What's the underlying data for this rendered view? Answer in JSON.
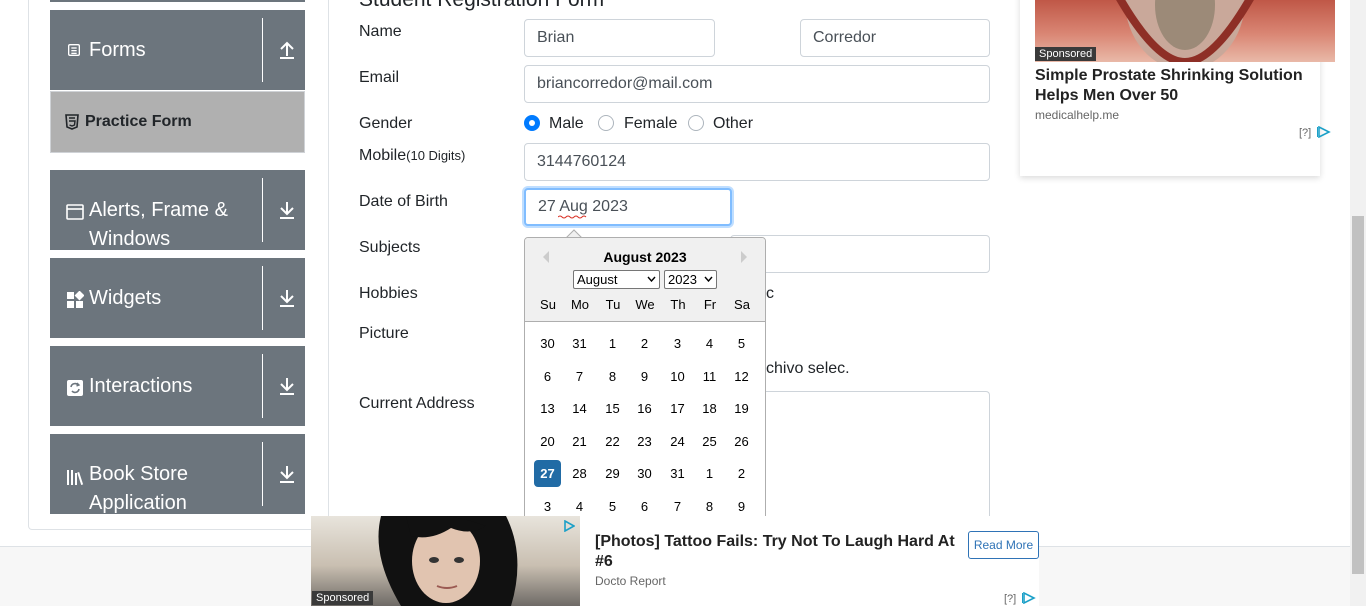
{
  "sidebar": {
    "groups": [
      {
        "label": "Forms",
        "icon": "document-icon",
        "arrow": "upload-arrow-icon"
      },
      {
        "label": "Alerts, Frame & Windows",
        "icon": "window-icon",
        "arrow": "download-arrow-icon"
      },
      {
        "label": "Widgets",
        "icon": "widgets-icon",
        "arrow": "download-arrow-icon"
      },
      {
        "label": "Interactions",
        "icon": "interactions-icon",
        "arrow": "download-arrow-icon"
      },
      {
        "label": "Book Store Application",
        "icon": "books-icon",
        "arrow": "download-arrow-icon"
      }
    ],
    "active_item": {
      "label": "Practice Form",
      "icon": "html5-icon"
    }
  },
  "form": {
    "title": "Student Registration Form",
    "labels": {
      "name": "Name",
      "email": "Email",
      "gender": "Gender",
      "mobile": "Mobile",
      "mobile_hint": "(10 Digits)",
      "dob": "Date of Birth",
      "subjects": "Subjects",
      "hobbies": "Hobbies",
      "picture": "Picture",
      "address": "Current Address"
    },
    "first_name": "Brian",
    "last_name": "Corredor",
    "email": "briancorredor@mail.com",
    "gender_options": [
      "Male",
      "Female",
      "Other"
    ],
    "gender_selected": "Male",
    "mobile": "3144760124",
    "dob": "27 Aug 2023",
    "hobbies_partial": "c",
    "picture_partial": "chivo selec."
  },
  "datepicker": {
    "title": "August 2023",
    "month_select": "August",
    "year_select": "2023",
    "weekdays": [
      "Su",
      "Mo",
      "Tu",
      "We",
      "Th",
      "Fr",
      "Sa"
    ],
    "weeks": [
      [
        "30",
        "31",
        "1",
        "2",
        "3",
        "4",
        "5"
      ],
      [
        "6",
        "7",
        "8",
        "9",
        "10",
        "11",
        "12"
      ],
      [
        "13",
        "14",
        "15",
        "16",
        "17",
        "18",
        "19"
      ],
      [
        "20",
        "21",
        "22",
        "23",
        "24",
        "25",
        "26"
      ],
      [
        "27",
        "28",
        "29",
        "30",
        "31",
        "1",
        "2"
      ],
      [
        "3",
        "4",
        "5",
        "6",
        "7",
        "8",
        "9"
      ]
    ],
    "selected_day": "27"
  },
  "ad_right": {
    "sponsored": "Sponsored",
    "headline": "Simple Prostate Shrinking Solution Helps Men Over 50",
    "source": "medicalhelp.me",
    "qmark": "[?]"
  },
  "ad_bottom": {
    "sponsored": "Sponsored",
    "headline": "[Photos] Tattoo Fails: Try Not To Laugh Hard At #6",
    "source": "Docto Report",
    "cta": "Read More",
    "qmark": "[?]"
  },
  "colors": {
    "sidebar_group": "#6c757d",
    "active_item": "#b0b0b0",
    "radio_checked": "#007bff",
    "selected_day": "#216ba5",
    "ad_link": "#2f73b6"
  }
}
